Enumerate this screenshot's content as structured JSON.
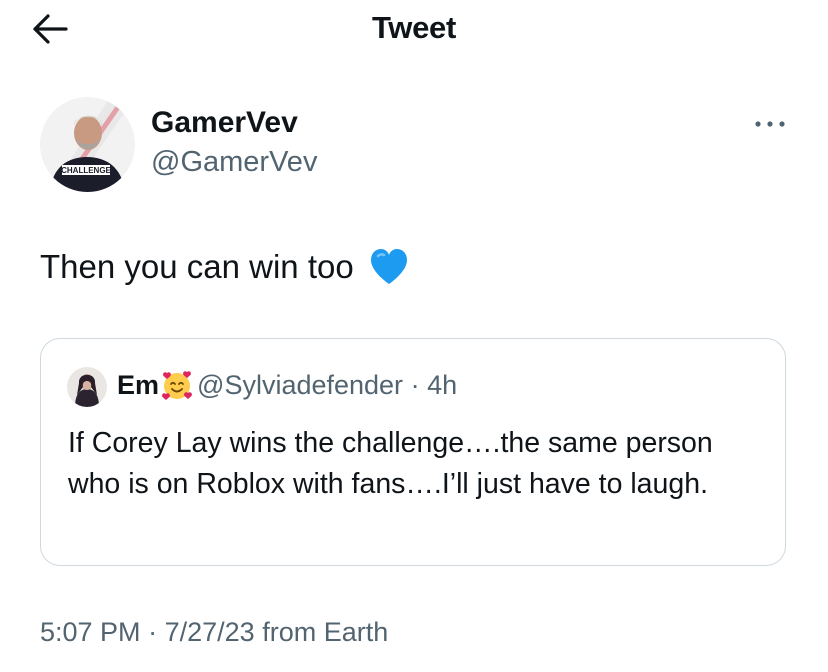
{
  "header": {
    "title": "Tweet",
    "back_icon": "arrow-left-icon"
  },
  "author": {
    "name": "GamerVev",
    "handle": "@GamerVev",
    "avatar_text": "CHALLENGE"
  },
  "tweet": {
    "text": "Then you can win too",
    "emoji": "blue-heart-icon"
  },
  "quote": {
    "name": "Em",
    "emoji": "smiling-face-with-hearts-icon",
    "handle": "@Sylviadefender",
    "separator": "·",
    "time": "4h",
    "text": "If Corey Lay wins the challenge….the same person who is on Roblox with fans….I’ll just have to laugh."
  },
  "footer": {
    "time": "5:07 PM",
    "separator": "·",
    "date": "7/27/23",
    "source": "from Earth"
  },
  "colors": {
    "text": "#0f1419",
    "secondary": "#536471",
    "border": "#cfd9de",
    "heart": "#1d9bf0"
  }
}
